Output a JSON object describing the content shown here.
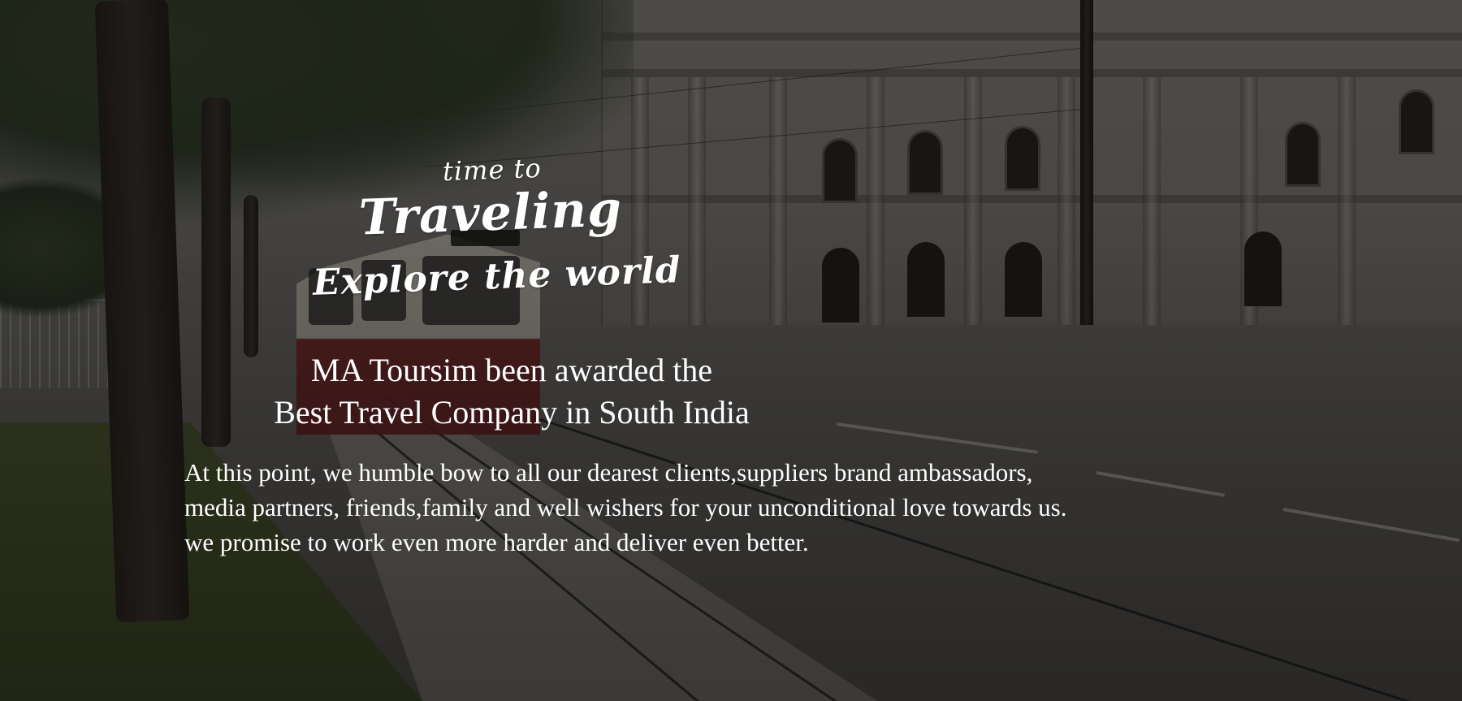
{
  "hero": {
    "headline": {
      "line1": "time to",
      "line2": "Traveling",
      "line3": "Explore the world"
    },
    "award": {
      "line1": "MA Toursim been awarded the",
      "line2": "Best Travel Company in South India"
    },
    "message": {
      "line1": "At this point, we humble bow to all our dearest clients,suppliers brand ambassadors,",
      "line2": "media partners, friends,family and well wishers for your unconditional love towards us.",
      "line3": "we promise to work even more harder and deliver even better."
    }
  }
}
